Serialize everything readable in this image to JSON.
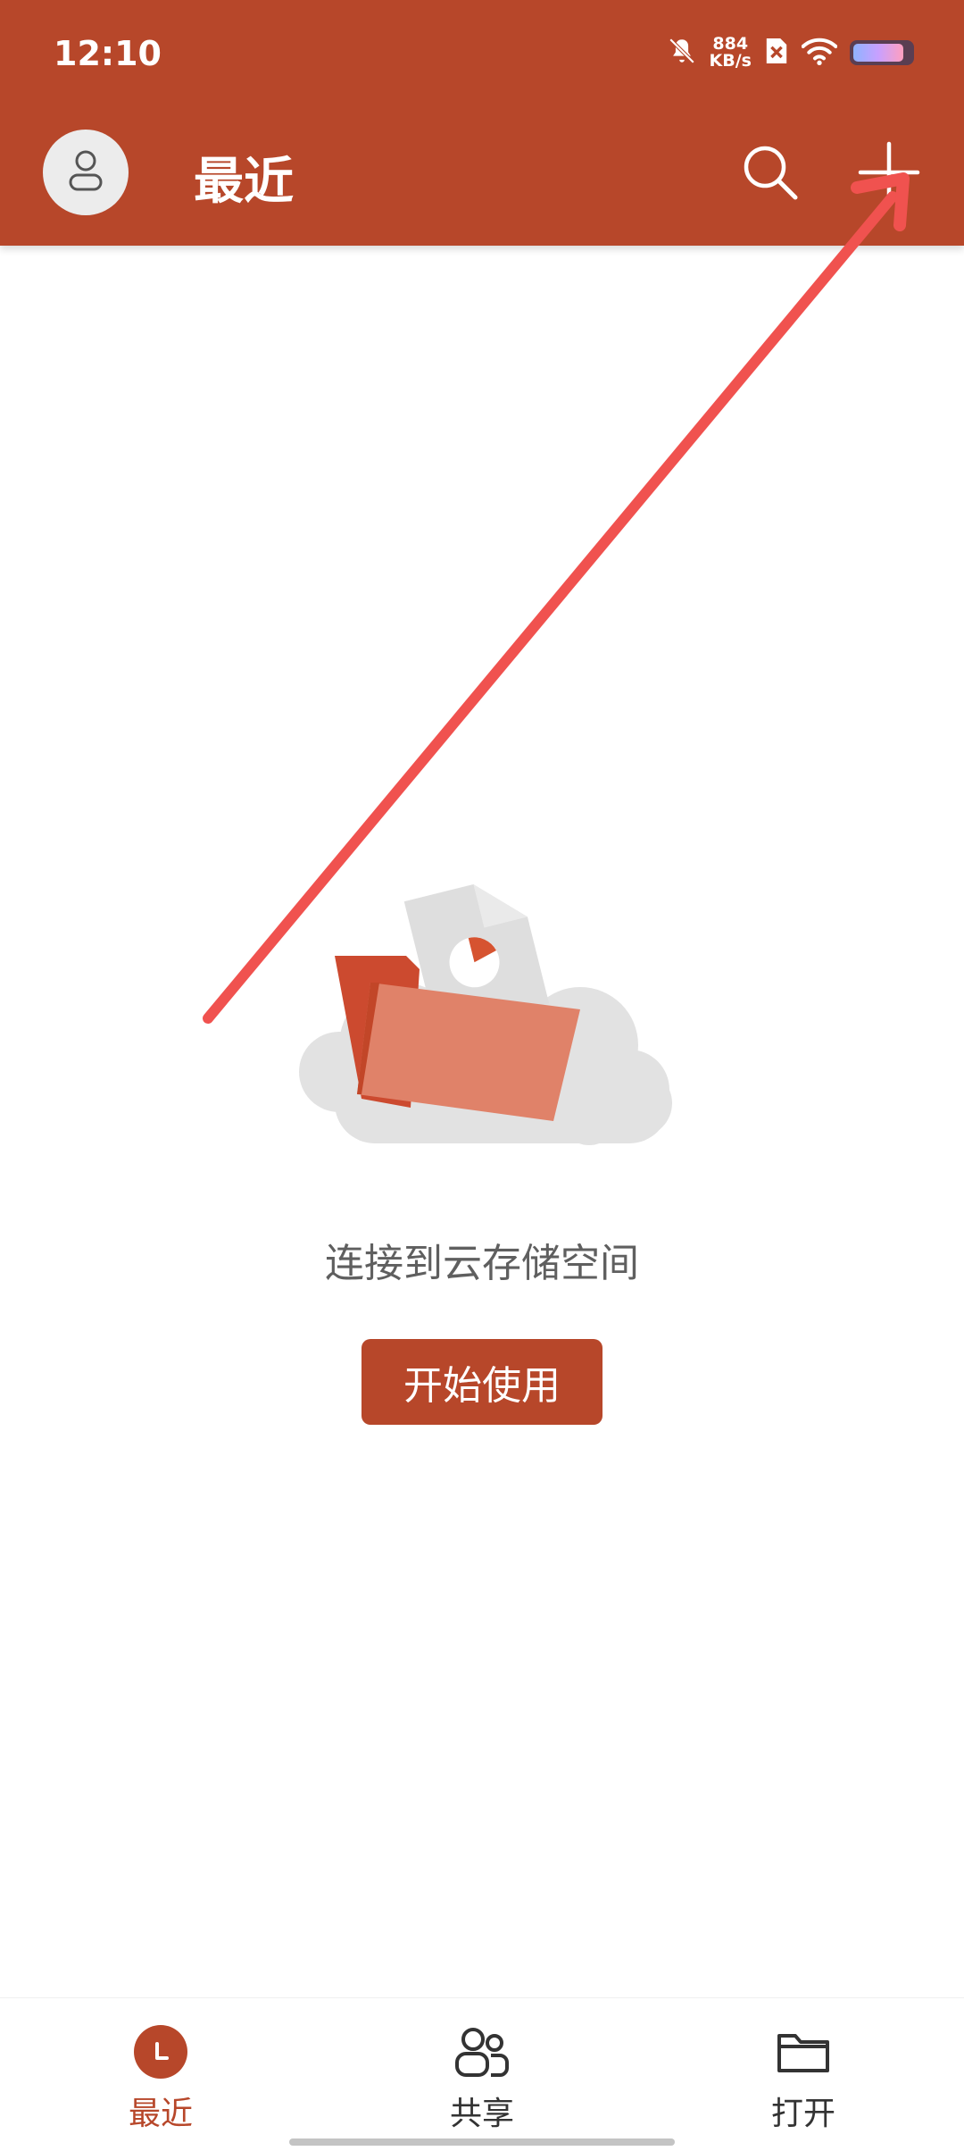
{
  "status_bar": {
    "time": "12:10",
    "net_speed_value": "884",
    "net_speed_unit": "KB/s",
    "icons": [
      "bell-off-icon",
      "sim-no-signal-icon",
      "wifi-icon",
      "battery-icon"
    ]
  },
  "header": {
    "title": "最近",
    "background_color": "#b7472a",
    "actions": [
      "search-icon",
      "plus-icon"
    ]
  },
  "empty_state": {
    "message": "连接到云存储空间",
    "button_label": "开始使用",
    "illustration": "folder-cloud-illustration"
  },
  "annotation": {
    "type": "arrow",
    "color": "#f0524f",
    "points_to": "add-button"
  },
  "bottom_nav": {
    "items": [
      {
        "label": "最近",
        "icon": "clock-icon",
        "active": true
      },
      {
        "label": "共享",
        "icon": "people-icon",
        "active": false
      },
      {
        "label": "打开",
        "icon": "folder-icon",
        "active": false
      }
    ],
    "accent_color": "#b7472a"
  }
}
